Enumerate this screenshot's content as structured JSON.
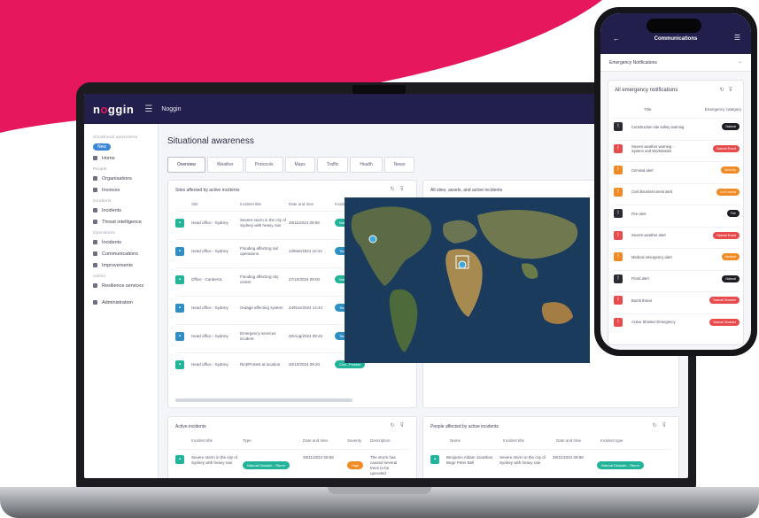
{
  "brand": {
    "logo_prefix": "n",
    "logo_mark": "o",
    "logo_suffix": "ggin",
    "accent": "#e6175c",
    "navy": "#231f4d"
  },
  "topbar": {
    "title": "Noggin"
  },
  "sidebar": {
    "section_title": "Situational awareness",
    "items": [
      {
        "label": "New",
        "group": "",
        "active": true
      },
      {
        "label": "Home",
        "group": ""
      },
      {
        "label": "Organisations",
        "group": "People"
      },
      {
        "label": "Invoices",
        "group": ""
      },
      {
        "label": "Incidents",
        "group": "Incidents"
      },
      {
        "label": "Threat intelligence",
        "group": ""
      },
      {
        "label": "Incidents",
        "group": "Operations"
      },
      {
        "label": "Communications",
        "group": ""
      },
      {
        "label": "Improvements",
        "group": ""
      },
      {
        "label": "Resilience services",
        "group": "Admin"
      },
      {
        "label": "Administration",
        "group": ""
      }
    ]
  },
  "main": {
    "title": "Situational awareness",
    "tabs": [
      "Overview",
      "Weather",
      "Protocols",
      "Maps",
      "Traffic",
      "Health",
      "News"
    ],
    "incident_panel": {
      "title": "Sites affected by active incidents",
      "columns": [
        "Site",
        "Incident title",
        "Date and time",
        "Incident type"
      ],
      "rows": [
        {
          "site": "Head office - Sydney",
          "title": "Severe storm in the city of Sydney with heavy rain",
          "date": "28/11/2024 09:58",
          "badge": "Natural Disaster - Storm",
          "color": "#23b39a",
          "icon": "#23b39a"
        },
        {
          "site": "Head office - Sydney",
          "title": "Flooding affecting rail operations",
          "date": "13/Mar/2024 10:44",
          "badge": "Technology - System Outage",
          "color": "#2d8fc4",
          "icon": "#2d8fc4"
        },
        {
          "site": "Office - Canberra",
          "title": "Flooding affecting city center",
          "date": "27/10/2024 09:00",
          "badge": "Natural Disaster - Flood",
          "color": "#23b39a",
          "icon": "#23b39a"
        },
        {
          "site": "Head office - Sydney",
          "title": "Outage affecting system",
          "date": "24/Nov/2024 14:44",
          "badge": "Technology - System Outage",
          "color": "#2d8fc4",
          "icon": "#2d8fc4"
        },
        {
          "site": "Head office - Sydney",
          "title": "Emergency services incident",
          "date": "20/Aug/2024 09:20",
          "badge": "Technology - System Outage",
          "color": "#2d8fc4",
          "icon": "#2d8fc4"
        },
        {
          "site": "Head office - Sydney",
          "title": "Riot/Protest at location",
          "date": "20/10/2024 09:20",
          "badge": "Civil - Protest",
          "color": "#23b39a",
          "icon": "#23b39a"
        }
      ]
    },
    "map_panel": {
      "title": "All sites, assets, and active incidents"
    },
    "active_panel": {
      "title": "Active incidents",
      "columns": [
        "Incident title",
        "Type",
        "Date and time",
        "Severity",
        "Description"
      ],
      "row": {
        "title": "Severe storm in the city of Sydney with heavy rain",
        "badge": "Natural Disaster - Storm",
        "date": "28/11/2024 09:58",
        "severity": "High",
        "description": "The storm has caused several trees to be uprooted"
      }
    },
    "people_panel": {
      "title": "People affected by active incidents",
      "columns": [
        "Name",
        "Incident title",
        "Date and time",
        "Incident type"
      ],
      "row": {
        "name": "Benjamin Aldam Jonathan Bege Peter Bell",
        "title": "Severe storm in the city of Sydney with heavy rain",
        "date": "28/11/2024 09:58",
        "badge": "Natural Disaster - Storm"
      }
    }
  },
  "phone": {
    "title": "Communications",
    "section": "Emergency Notifications",
    "card_title": "All emergency notifications",
    "columns": [
      "Title",
      "Emergency category"
    ],
    "rows": [
      {
        "title": "Construction site safety warning",
        "badge": "Natural",
        "color": "#1e1e24",
        "icon": "#2b2b33"
      },
      {
        "title": "Severe weather warning - System and Workstation",
        "badge": "Natural Event",
        "color": "#e84b4b",
        "icon": "#e84b4b"
      },
      {
        "title": "Criminal alert",
        "badge": "Security",
        "color": "#f08a24",
        "icon": "#f08a24"
      },
      {
        "title": "Civil disorder/unrest alert",
        "badge": "Civil Unrest",
        "color": "#f08a24",
        "icon": "#f08a24"
      },
      {
        "title": "Fire alert",
        "badge": "Fire",
        "color": "#1e1e24",
        "icon": "#2b2b33"
      },
      {
        "title": "Severe weather alert",
        "badge": "Natural Event",
        "color": "#e84b4b",
        "icon": "#e84b4b"
      },
      {
        "title": "Medical emergency alert",
        "badge": "Medical",
        "color": "#f08a24",
        "icon": "#f08a24"
      },
      {
        "title": "Flood alert",
        "badge": "Natural",
        "color": "#1e1e24",
        "icon": "#2b2b33"
      },
      {
        "title": "Bomb threat",
        "badge": "Natural Disaster",
        "color": "#e84b4b",
        "icon": "#e84b4b"
      },
      {
        "title": "Active Shooter Emergency",
        "badge": "Natural Disaster",
        "color": "#e84b4b",
        "icon": "#e84b4b"
      }
    ]
  }
}
